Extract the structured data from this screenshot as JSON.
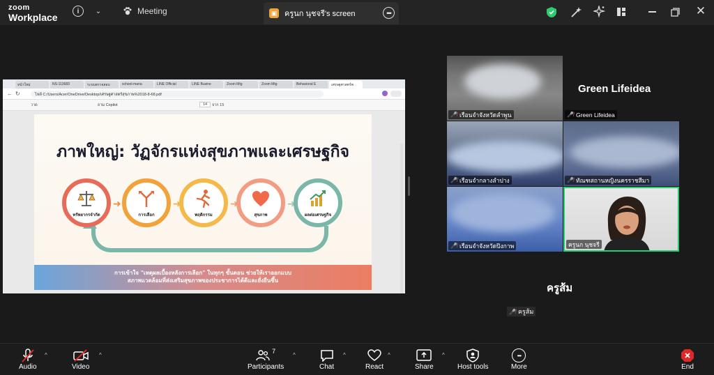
{
  "app": {
    "logo_line1": "zoom",
    "logo_line2": "Workplace",
    "meeting_label": "Meeting",
    "screen_tab_title": "ครูนก นุชจรี's screen"
  },
  "colors": {
    "security_green": "#2ecc71",
    "end_red": "#e02828",
    "active_speaker": "#2ecc71"
  },
  "browser": {
    "tabs": [
      "หน้าใหม่",
      "NS-113683",
      "ระบบตรวจสอบ",
      "school-mana",
      "LINE Official",
      "LINE Busine",
      "Zoom Mtg",
      "Zoom Mtg",
      "Behavioral E",
      "เศรษฐศาสตร์พ"
    ],
    "url": "ไฟล์  C:/Users/Acer/OneDrive/Desktop/เศรษฐศาสตร์สุขภาพ%2018-8-68.pdf",
    "ask_copilot": "ถาม Copilot",
    "page_num": "14",
    "page_total": "จาก 15",
    "view_label": "วาด"
  },
  "slide": {
    "title": "ภาพใหญ่: วัฏจักรแห่งสุขภาพและเศรษฐกิจ",
    "steps": [
      "ทรัพยากรจำกัด",
      "การเลือก",
      "พฤติกรรม",
      "สุขภาพ",
      "ผลต่อเศรษฐกิจ"
    ],
    "banner_line1": "การเข้าใจ \"เหตุผลเบื้องหลังการเลือก\" ในทุกๆ ขั้นตอน ช่วยให้เราออกแบบ",
    "banner_line2": "สภาพแวดล้อมที่ส่งเสริมสุขภาพของประชาการได้ดีและยั่งยืนขึ้น"
  },
  "participants_grid": [
    {
      "name": "เรือนจำจังหวัดลำพูน",
      "muted": true
    },
    {
      "name": "Green Lifeidea",
      "muted": true,
      "display_name": "Green Lifeidea"
    },
    {
      "name": "เรือนจำกลางลำปาง",
      "muted": true
    },
    {
      "name": "ทัณฑสถานหญิงนครราชสีมา",
      "muted": true
    },
    {
      "name": "เรือนจำจังหวัดปิงกาพ",
      "muted": true
    },
    {
      "name": "ครูนก นุชจรี",
      "muted": false
    }
  ],
  "extra_participant": {
    "display_name": "ครูส้ม",
    "name": "ครูส้ม",
    "muted": true
  },
  "toolbar": {
    "audio": "Audio",
    "video": "Video",
    "participants": "Participants",
    "participants_count": "7",
    "chat": "Chat",
    "react": "React",
    "share": "Share",
    "host_tools": "Host tools",
    "more": "More",
    "end": "End"
  }
}
